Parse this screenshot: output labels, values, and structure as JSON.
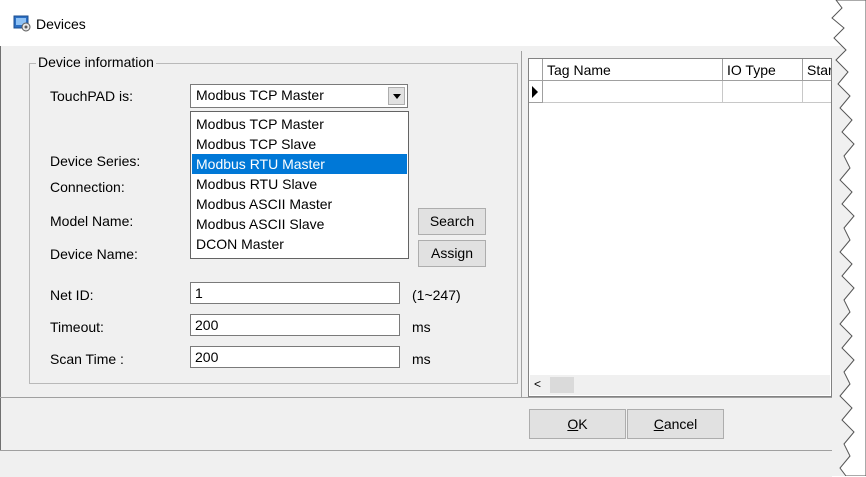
{
  "window": {
    "title": "Devices"
  },
  "device_info": {
    "group_title": "Device information",
    "touchpad_label": "TouchPAD is:",
    "touchpad_value": "Modbus TCP Master",
    "dropdown_options": [
      "Modbus TCP Master",
      "Modbus TCP Slave",
      "Modbus RTU Master",
      "Modbus RTU Slave",
      "Modbus ASCII Master",
      "Modbus ASCII Slave",
      "DCON Master"
    ],
    "selected_option": "Modbus RTU Master",
    "device_series_label": "Device Series:",
    "connection_label": "Connection:",
    "model_name_label": "Model Name:",
    "device_name_label": "Device Name:",
    "search_button": "Search",
    "assign_button": "Assign",
    "net_id_label": "Net ID:",
    "net_id_value": "1",
    "net_id_range": "(1~247)",
    "timeout_label": "Timeout:",
    "timeout_value": "200",
    "timeout_unit": "ms",
    "scan_time_label": "Scan Time :",
    "scan_time_value": "200",
    "scan_time_unit": "ms"
  },
  "tag_grid": {
    "columns": [
      "Tag Name",
      "IO Type",
      "Start"
    ]
  },
  "footer": {
    "ok_letter": "O",
    "ok_rest": "K",
    "cancel_letter": "C",
    "cancel_rest": "ancel"
  },
  "colors": {
    "selection": "#0078d7"
  }
}
